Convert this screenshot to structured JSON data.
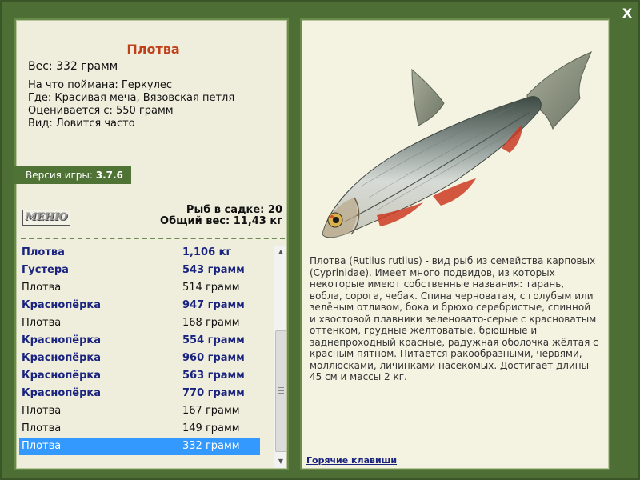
{
  "window": {
    "close_label": "X"
  },
  "left": {
    "fish_name": "Плотва",
    "weight": "Вес: 332 грамм",
    "info": [
      "На что поймана: Геркулес",
      "Где: Красивая меча, Вязовская петля",
      "Оценивается с: 550 грамм",
      "Вид: Ловится часто"
    ],
    "version_label": "Версия игры: ",
    "version_value": "3.7.6",
    "menu_label": "МЕНЮ",
    "keep_count": "Рыб в садке: 20",
    "total_weight": "Общий вес: 11,43 кг"
  },
  "catch_list": [
    {
      "name": "Плотва",
      "weight": "1,106 кг",
      "style": "trophy"
    },
    {
      "name": "Густера",
      "weight": "543 грамм",
      "style": "trophy"
    },
    {
      "name": "Плотва",
      "weight": "514 грамм",
      "style": "normal"
    },
    {
      "name": "Краснопёрка",
      "weight": "947 грамм",
      "style": "trophy"
    },
    {
      "name": "Плотва",
      "weight": "168 грамм",
      "style": "normal"
    },
    {
      "name": "Краснопёрка",
      "weight": "554 грамм",
      "style": "trophy"
    },
    {
      "name": "Краснопёрка",
      "weight": "960 грамм",
      "style": "trophy"
    },
    {
      "name": "Краснопёрка",
      "weight": "563 грамм",
      "style": "trophy"
    },
    {
      "name": "Краснопёрка",
      "weight": "770 грамм",
      "style": "trophy"
    },
    {
      "name": "Плотва",
      "weight": "167 грамм",
      "style": "normal"
    },
    {
      "name": "Плотва",
      "weight": "149 грамм",
      "style": "normal"
    },
    {
      "name": "Плотва",
      "weight": "332 грамм",
      "style": "selected"
    }
  ],
  "right": {
    "description": "Плотва (Rutilus rutilus) - вид рыб из семейства карповых (Cyprinidae). Имеет много подвидов, из которых некоторые имеют собственные названия: тарань, вобла, сорога, чебак. Спина черноватая, с голубым или зелёным отливом, бока и брюхо серебристые, спинной и хвостовой плавники зеленовато-серые с красноватым оттенком, грудные желтоватые, брюшные и заднепроходный красные, радужная оболочка жёлтая с красным пятном. Питается ракообразными, червями, моллюсками, личинками насекомых. Достигает длины 45 см и массы 2 кг.",
    "hotkeys_label": "Горячие клавиши"
  },
  "colors": {
    "frame": "#4d6e35",
    "panel": "#efeedd",
    "title": "#c0401a",
    "trophy_text": "#1a237e",
    "selected": "#3399ff"
  }
}
